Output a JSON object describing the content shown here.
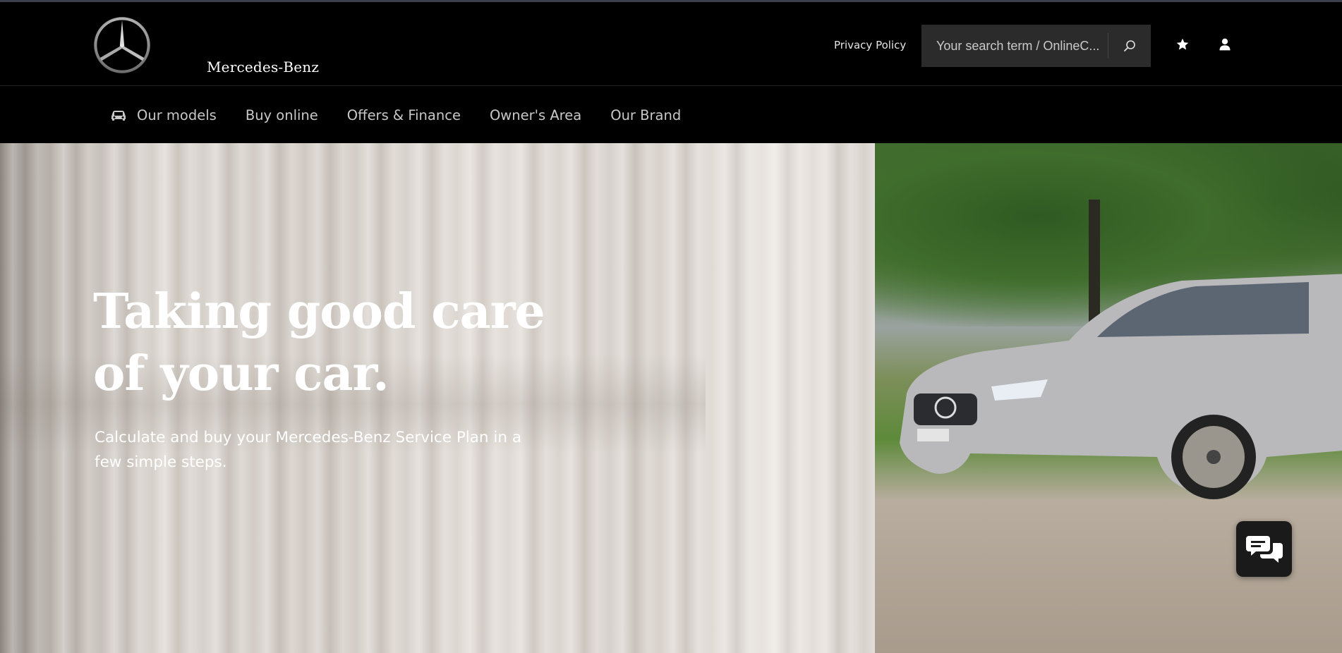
{
  "header": {
    "brand_name": "Mercedes-Benz",
    "privacy_link": "Privacy Policy",
    "search": {
      "placeholder": "Your search term / OnlineC..."
    },
    "icons": {
      "logo": "mercedes-star-logo",
      "search": "search-icon",
      "favorites": "star-icon",
      "account": "user-icon"
    }
  },
  "nav": {
    "items": [
      {
        "label": "Our models",
        "icon": "car-icon"
      },
      {
        "label": "Buy online"
      },
      {
        "label": "Offers & Finance"
      },
      {
        "label": "Owner's Area"
      },
      {
        "label": "Our Brand"
      }
    ]
  },
  "hero": {
    "title": "Taking good care of your car.",
    "subtitle": "Calculate and buy your Mercedes-Benz Service Plan in a few simple steps.",
    "chat_icon": "chat-bubbles-icon"
  },
  "colors": {
    "header_bg": "#000000",
    "search_bg": "#2b2b2b",
    "nav_text": "#c8c8c8",
    "chat_bg": "#1a1a1a"
  }
}
